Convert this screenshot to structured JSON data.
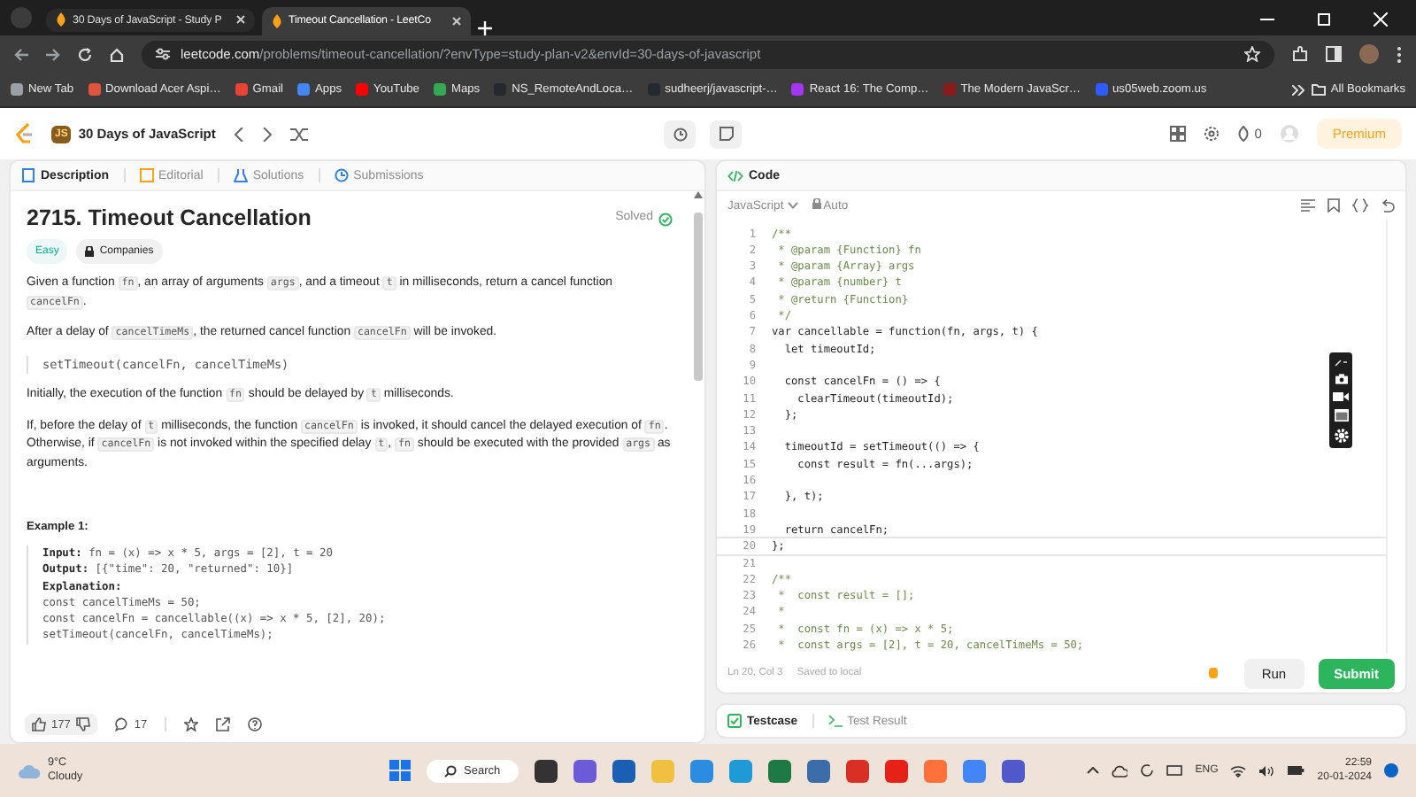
{
  "browser": {
    "tabs": [
      {
        "title": "30 Days of JavaScript - Study P",
        "selected": false
      },
      {
        "title": "Timeout Cancellation - LeetCo",
        "selected": true
      }
    ],
    "url": {
      "host": "leetcode.com",
      "path": "/problems/timeout-cancellation/?envType=study-plan-v2&envId=30-days-of-javascript"
    },
    "bookmarks": [
      {
        "label": "New Tab",
        "color": "#9aa0a6"
      },
      {
        "label": "Download Acer Aspi…",
        "color": "#e0543c"
      },
      {
        "label": "Gmail",
        "color": "#ea4335"
      },
      {
        "label": "Apps",
        "color": "#4285f4"
      },
      {
        "label": "YouTube",
        "color": "#ff0000"
      },
      {
        "label": "Maps",
        "color": "#34a853"
      },
      {
        "label": "NS_RemoteAndLoca…",
        "color": "#24292f"
      },
      {
        "label": "sudheerj/javascript-…",
        "color": "#24292f"
      },
      {
        "label": "React 16: The Comp…",
        "color": "#a435f0"
      },
      {
        "label": "The Modern JavaScr…",
        "color": "#8b1a1a"
      },
      {
        "label": "us05web.zoom.us",
        "color": "#2d5bff"
      }
    ],
    "all_bookmarks": "All Bookmarks"
  },
  "header": {
    "badge": "JS",
    "study_plan": "30 Days of JavaScript",
    "streak": "0",
    "premium": "Premium"
  },
  "description_panel": {
    "tabs": [
      {
        "label": "Description",
        "selected": true
      },
      {
        "label": "Editorial",
        "selected": false
      },
      {
        "label": "Solutions",
        "selected": false
      },
      {
        "label": "Submissions",
        "selected": false
      }
    ],
    "title": "2715. Timeout Cancellation",
    "status": "Solved",
    "tags": [
      {
        "label": "Easy",
        "kind": "difficulty"
      },
      {
        "label": "Companies",
        "kind": "locked"
      }
    ],
    "content": [
      {
        "kind": "paragraph",
        "parts": [
          {
            "text": "Given a function ",
            "kind": "text"
          },
          {
            "text": "fn",
            "kind": "code"
          },
          {
            "text": ", an array of arguments ",
            "kind": "text"
          },
          {
            "text": "args",
            "kind": "code"
          },
          {
            "text": ", and a timeout ",
            "kind": "text"
          },
          {
            "text": "t",
            "kind": "code"
          },
          {
            "text": " in milliseconds, return a cancel function ",
            "kind": "text"
          },
          {
            "text": "cancelFn",
            "kind": "code"
          },
          {
            "text": ".",
            "kind": "text"
          }
        ]
      },
      {
        "kind": "paragraph",
        "parts": [
          {
            "text": "After a delay of ",
            "kind": "text"
          },
          {
            "text": "cancelTimeMs",
            "kind": "code"
          },
          {
            "text": ", the returned cancel function ",
            "kind": "text"
          },
          {
            "text": "cancelFn",
            "kind": "code"
          },
          {
            "text": " will be invoked.",
            "kind": "text"
          }
        ]
      },
      {
        "kind": "code",
        "text": "setTimeout(cancelFn, cancelTimeMs)"
      },
      {
        "kind": "paragraph",
        "parts": [
          {
            "text": "Initially, the execution of the function ",
            "kind": "text"
          },
          {
            "text": "fn",
            "kind": "code"
          },
          {
            "text": " should be delayed by ",
            "kind": "text"
          },
          {
            "text": "t",
            "kind": "code"
          },
          {
            "text": " milliseconds.",
            "kind": "text"
          }
        ]
      },
      {
        "kind": "paragraph",
        "parts": [
          {
            "text": "If, before the delay of ",
            "kind": "text"
          },
          {
            "text": "t",
            "kind": "code"
          },
          {
            "text": " milliseconds, the function ",
            "kind": "text"
          },
          {
            "text": "cancelFn",
            "kind": "code"
          },
          {
            "text": " is invoked, it should cancel the delayed execution of ",
            "kind": "text"
          },
          {
            "text": "fn",
            "kind": "code"
          },
          {
            "text": ". Otherwise, if ",
            "kind": "text"
          },
          {
            "text": "cancelFn",
            "kind": "code"
          },
          {
            "text": " is not invoked within the specified delay ",
            "kind": "text"
          },
          {
            "text": "t",
            "kind": "code"
          },
          {
            "text": ", ",
            "kind": "text"
          },
          {
            "text": "fn",
            "kind": "code"
          },
          {
            "text": " should be executed with the provided ",
            "kind": "text"
          },
          {
            "text": "args",
            "kind": "code"
          },
          {
            "text": " as arguments.",
            "kind": "text"
          }
        ]
      }
    ],
    "example_title": "Example 1:",
    "example_lines": [
      "**Input:** fn = (x) => x * 5, args = [2], t = 20",
      "**Output:** [{\"time\": 20, \"returned\": 10}]",
      "**Explanation:**",
      "const cancelTimeMs = 50;",
      "const cancelFn = cancellable((x) => x * 5, [2], 20);",
      "setTimeout(cancelFn, cancelTimeMs);"
    ],
    "likes": "177",
    "comments": "17"
  },
  "code_panel": {
    "title": "Code",
    "language": "JavaScript",
    "mode": "Auto",
    "lines": [
      {
        "number": "1",
        "text": "/**",
        "kind": "comment",
        "selected": false
      },
      {
        "number": "2",
        "text": " * @param {Function} fn",
        "kind": "comment",
        "selected": false
      },
      {
        "number": "3",
        "text": " * @param {Array} args",
        "kind": "comment",
        "selected": false
      },
      {
        "number": "4",
        "text": " * @param {number} t",
        "kind": "comment",
        "selected": false
      },
      {
        "number": "5",
        "text": " * @return {Function}",
        "kind": "comment",
        "selected": false
      },
      {
        "number": "6",
        "text": " */",
        "kind": "comment",
        "selected": false
      },
      {
        "number": "7",
        "text": "var cancellable = function(fn, args, t) {",
        "kind": "code",
        "selected": false
      },
      {
        "number": "8",
        "text": "  let timeoutId;",
        "kind": "code",
        "selected": false
      },
      {
        "number": "9",
        "kind": "code",
        "selected": false
      },
      {
        "number": "10",
        "text": "  const cancelFn = () => {",
        "kind": "code",
        "selected": false
      },
      {
        "number": "11",
        "text": "    clearTimeout(timeoutId);",
        "kind": "code",
        "selected": false
      },
      {
        "number": "12",
        "text": "  };",
        "kind": "code",
        "selected": false
      },
      {
        "number": "13",
        "kind": "code",
        "selected": false
      },
      {
        "number": "14",
        "text": "  timeoutId = setTimeout(() => {",
        "kind": "code",
        "selected": false
      },
      {
        "number": "15",
        "text": "    const result = fn(...args);",
        "kind": "code",
        "selected": false
      },
      {
        "number": "16",
        "kind": "code",
        "selected": false
      },
      {
        "number": "17",
        "text": "  }, t);",
        "kind": "code",
        "selected": false
      },
      {
        "number": "18",
        "kind": "code",
        "selected": false
      },
      {
        "number": "19",
        "text": "  return cancelFn;",
        "kind": "code",
        "selected": false
      },
      {
        "number": "20",
        "text": "};",
        "kind": "code",
        "selected": true
      },
      {
        "number": "21",
        "kind": "code",
        "selected": false
      },
      {
        "number": "22",
        "text": "/**",
        "kind": "comment",
        "selected": false
      },
      {
        "number": "23",
        "text": " *  const result = [];",
        "kind": "comment",
        "selected": false
      },
      {
        "number": "24",
        "text": " *",
        "kind": "comment",
        "selected": false
      },
      {
        "number": "25",
        "text": " *  const fn = (x) => x * 5;",
        "kind": "comment",
        "selected": false
      },
      {
        "number": "26",
        "text": " *  const args = [2], t = 20, cancelTimeMs = 50;",
        "kind": "comment",
        "selected": false
      }
    ],
    "cursor": "Ln 20, Col 3",
    "saved": "Saved to local",
    "run": "Run",
    "submit": "Submit",
    "bottom_tabs": [
      {
        "label": "Testcase",
        "selected": true
      },
      {
        "label": "Test Result",
        "selected": false
      }
    ]
  },
  "taskbar": {
    "temperature": "9°C",
    "weather": "Cloudy",
    "search": "Search",
    "language": "ENG",
    "time": "22:59",
    "date": "20-01-2024"
  }
}
